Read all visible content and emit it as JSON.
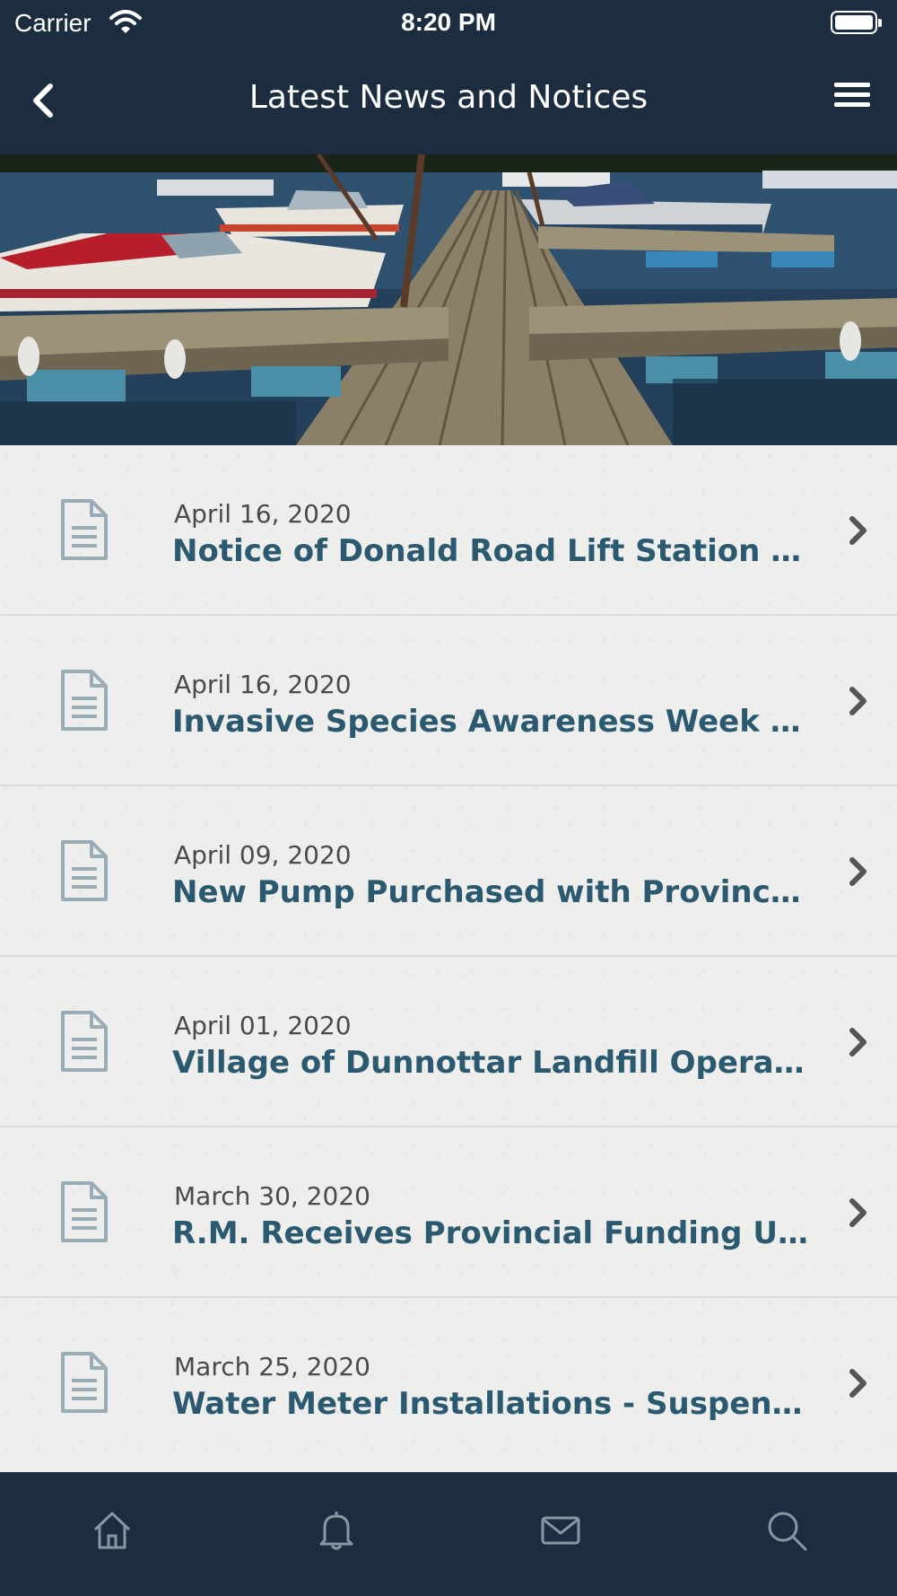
{
  "status_bar": {
    "carrier": "Carrier",
    "time": "8:20 PM"
  },
  "nav": {
    "title": "Latest News and Notices",
    "back_icon": "chevron-left-icon",
    "menu_icon": "hamburger-menu-icon"
  },
  "hero": {
    "image": "marina-dock-with-boats"
  },
  "news_items": [
    {
      "date": "April 16, 2020",
      "title": "Notice of Donald Road Lift Station and ..."
    },
    {
      "date": "April 16, 2020",
      "title": "Invasive Species Awareness Week in M..."
    },
    {
      "date": "April 09, 2020",
      "title": "New Pump Purchased with Provincial ..."
    },
    {
      "date": "April 01, 2020",
      "title": "Village of Dunnottar Landfill Operation..."
    },
    {
      "date": "March 30, 2020",
      "title": "R.M. Receives Provincial Funding Unde..."
    },
    {
      "date": "March 25, 2020",
      "title": "Water Meter Installations - Suspension..."
    }
  ],
  "tab_bar": {
    "tabs": [
      "home-icon",
      "bell-icon",
      "mail-icon",
      "search-icon"
    ]
  },
  "colors": {
    "bar_background": "#1d2d40",
    "title_text": "#2b5a70",
    "date_text": "#4a4a4a",
    "icon_grey": "#9aacb6",
    "list_background": "#eeeeec"
  }
}
